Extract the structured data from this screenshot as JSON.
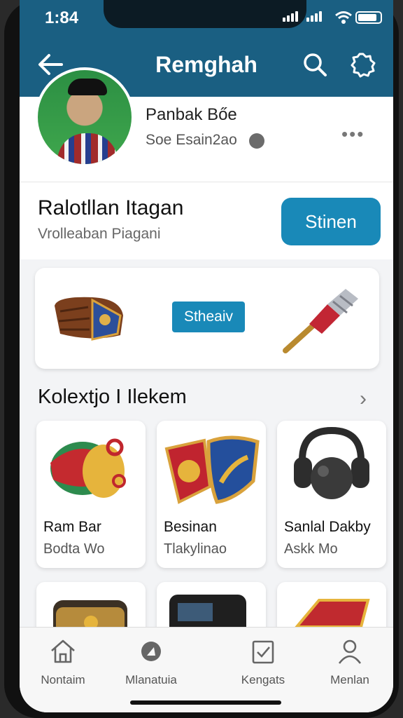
{
  "status": {
    "time": "1:84"
  },
  "header": {
    "title": "Remghah"
  },
  "profile": {
    "name": "Panbak Bőe",
    "subtitle": "Soe Esain2ao"
  },
  "section": {
    "title": "Ralotllan Itagan",
    "subtitle": "Vrolleaban Piagani",
    "button_label": "Stinen"
  },
  "showcase": {
    "button_label": "Stheaiv"
  },
  "collection": {
    "title": "Kolextjo I Ilekem",
    "items": [
      {
        "name": "Ram Bar",
        "sub": "Bodta Wo"
      },
      {
        "name": "Besinan",
        "sub": "Tlakylinao"
      },
      {
        "name": "Sanlal Dakby",
        "sub": "Askk Mo"
      }
    ]
  },
  "tabs": [
    {
      "label": "Nontaim",
      "icon": "home-icon"
    },
    {
      "label": "Mlanatuia",
      "icon": "explore-icon"
    },
    {
      "label": "Kengats",
      "icon": "checklist-icon"
    },
    {
      "label": "Menlan",
      "icon": "profile-icon"
    }
  ],
  "colors": {
    "primary": "#1a5f82",
    "accent": "#1989b8"
  }
}
